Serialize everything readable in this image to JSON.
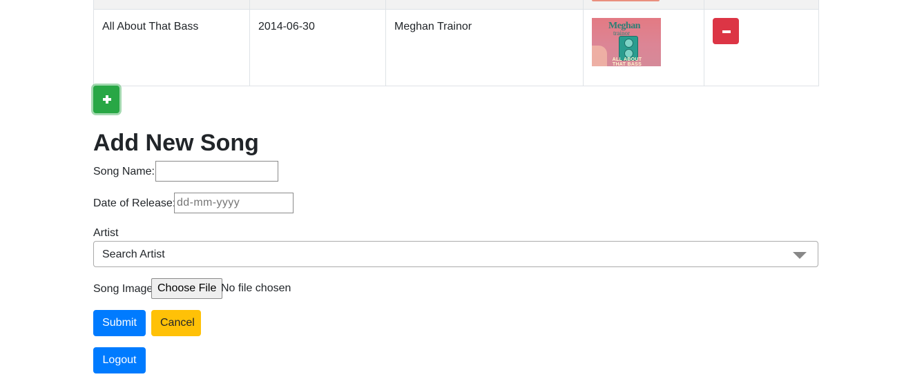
{
  "table": {
    "row": {
      "song_name": "All About That Bass",
      "release_date": "2014-06-30",
      "artist": "Meghan Trainor",
      "image": {
        "alt": "Meghan Trainor – All About That Bass cover",
        "title_text": "Meghan",
        "subtitle_text": "trainor",
        "footer_text": "ALL ABOUT THAT BASS"
      },
      "delete_icon": "minus-icon"
    }
  },
  "add_button_icon": "plus-icon",
  "form": {
    "title": "Add New Song",
    "song_name_label": "Song Name:",
    "song_name_value": "",
    "date_label": "Date of Release:",
    "date_placeholder": "dd-mm-yyyy",
    "artist_label": "Artist",
    "artist_select_text": "Search Artist",
    "image_label": "Song Image",
    "file_button_label": "Choose File",
    "file_status": "No file chosen",
    "submit_label": "Submit",
    "cancel_label": "Cancel"
  },
  "logout_label": "Logout",
  "colors": {
    "primary": "#007bff",
    "danger": "#dc3545",
    "success": "#28a745",
    "warning": "#ffc107"
  }
}
